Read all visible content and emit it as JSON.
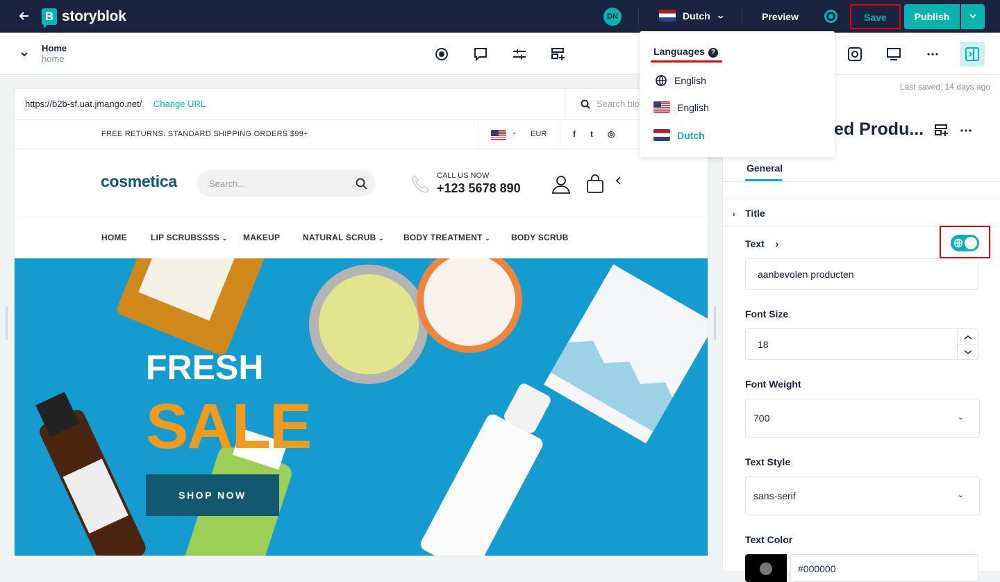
{
  "topbar": {
    "back_icon": "arrow-left-icon",
    "logo_letter": "B",
    "logo_text": "storyblok",
    "avatar_initials": "DN",
    "language": "Dutch",
    "preview": "Preview",
    "save": "Save",
    "publish": "Publish"
  },
  "toolbar": {
    "story_title": "Home",
    "story_slug": "home"
  },
  "canvas": {
    "url": "https://b2b-sf.uat.jmango.net/",
    "change_url": "Change URL",
    "search_placeholder": "Search blo",
    "promo": "FREE RETURNS. STANDARD SHIPPING ORDERS $99+",
    "currency": "EUR",
    "social": [
      "f",
      "t",
      "◎"
    ],
    "brand": "cosmetica",
    "site_search_placeholder": "Search...",
    "call_label": "CALL US NOW",
    "call_number": "+123 5678 890",
    "nav": [
      "HOME",
      "LIP SCRUBSSSS",
      "MAKEUP",
      "NATURAL SCRUB",
      "BODY TREATMENT",
      "BODY SCRUB"
    ],
    "hero_line1": "FRESH",
    "hero_line2": "SALE",
    "shop_now": "SHOP NOW"
  },
  "panel": {
    "last_saved": "Last saved: 14 days ago",
    "title": "ed Produ...",
    "tab": "General",
    "section_title": "Title",
    "text_label": "Text",
    "text_value": "aanbevolen producten",
    "font_size_label": "Font Size",
    "font_size_value": "18",
    "font_weight_label": "Font Weight",
    "font_weight_value": "700",
    "text_style_label": "Text Style",
    "text_style_value": "sans-serif",
    "text_color_label": "Text Color",
    "text_color_value": "#000000"
  },
  "language_dropdown": {
    "title": "Languages",
    "items": [
      {
        "label": "English",
        "icon": "globe-icon"
      },
      {
        "label": "English",
        "icon": "us-flag-icon"
      },
      {
        "label": "Dutch",
        "icon": "nl-flag-icon"
      }
    ]
  },
  "colors": {
    "brand_dark": "#1b243f",
    "accent": "#09b3af",
    "highlight": "#e3000f",
    "hero_blue": "#149cd1",
    "sale_orange": "#f49a1a"
  }
}
